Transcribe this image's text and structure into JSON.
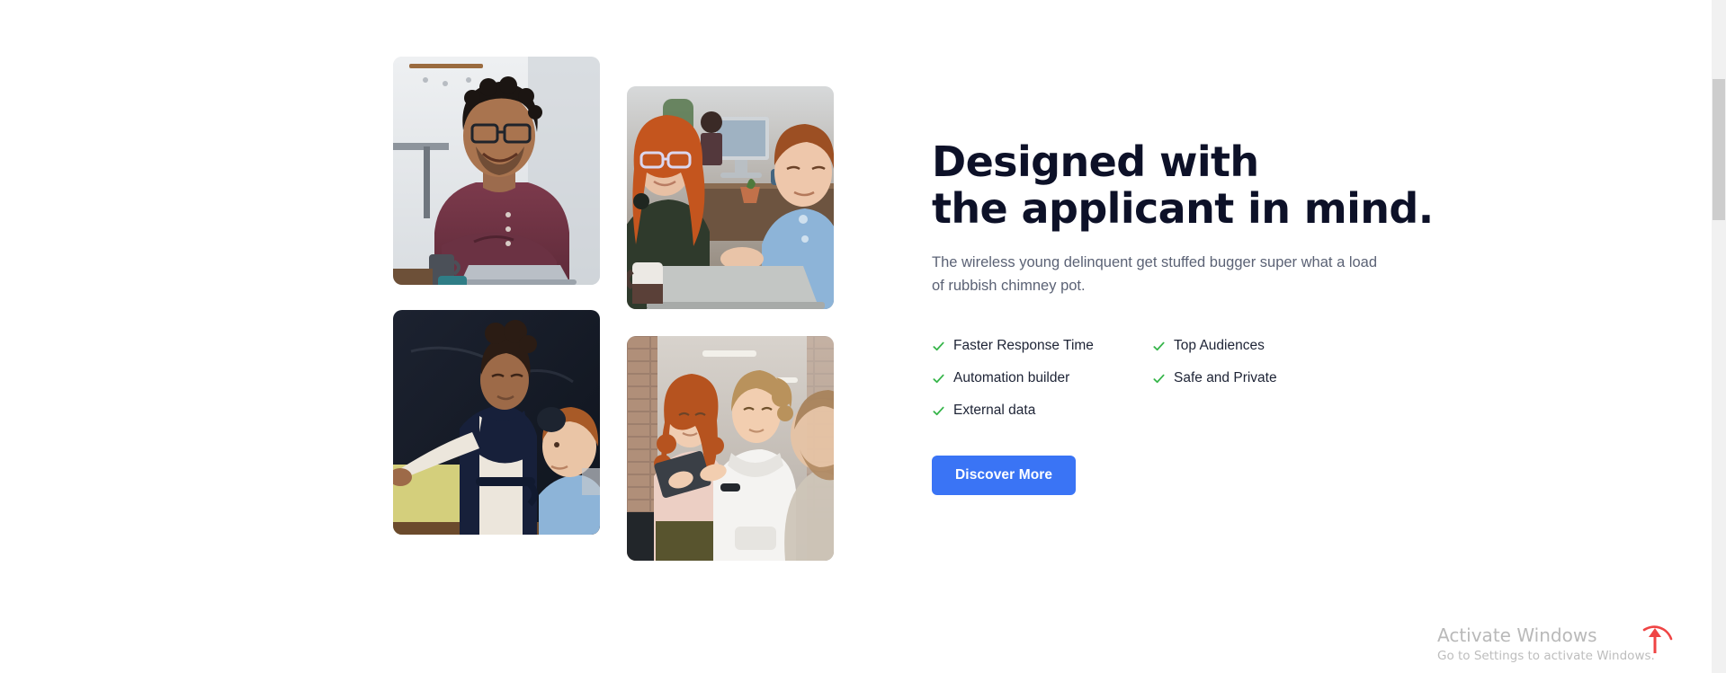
{
  "page": {
    "background_color": "#ffffff"
  },
  "hero": {
    "headline_line_1": "Designed with",
    "headline_line_2": "the applicant in mind.",
    "headline_color": "#0d1128",
    "subtext": "The wireless young delinquent get stuffed bugger super what a load of rubbish chimney pot.",
    "subtext_color": "#5b6275",
    "features": [
      {
        "label": "Faster Response Time",
        "icon": "check-icon"
      },
      {
        "label": "Top Audiences",
        "icon": "check-icon"
      },
      {
        "label": "Automation builder",
        "icon": "check-icon"
      },
      {
        "label": "Safe and Private",
        "icon": "check-icon"
      },
      {
        "label": "External data",
        "icon": "check-icon"
      }
    ],
    "check_color": "#36b54a",
    "cta_label": "Discover More",
    "cta_color": "#3a74f5",
    "cta_text_color": "#ffffff"
  },
  "collage": {
    "photos": [
      {
        "name": "photo-man-at-laptop",
        "alt": "Smiling man with glasses and dark curly hair in a maroon henley shirt sitting with arms crossed behind an open laptop in a bright cafe"
      },
      {
        "name": "photo-two-colleagues-laptop",
        "alt": "Red-haired woman wearing light eyeglasses and a dark green shirt working beside a man in a light blue shirt over a silver laptop in an open office"
      },
      {
        "name": "photo-woman-presenting-chalkboard",
        "alt": "Woman in a navy sleeveless vest gesturing toward a dark chalkboard while a red-haired young man in a blue shirt looks on"
      },
      {
        "name": "photo-women-with-tablet",
        "alt": "Two young women reviewing a tablet together in front of an exposed brick wall with a bearded man blurred in the foreground"
      }
    ]
  },
  "watermark": {
    "title": "Activate Windows",
    "subtitle": "Go to Settings to activate Windows.",
    "color": "#b9b9b9"
  },
  "back_to_top": {
    "icon": "arrow-up-icon",
    "color": "#ef4444"
  },
  "scrollbar": {
    "orientation": "vertical",
    "track_color": "#f1f1f1",
    "thumb_color": "#cdcdcd"
  }
}
